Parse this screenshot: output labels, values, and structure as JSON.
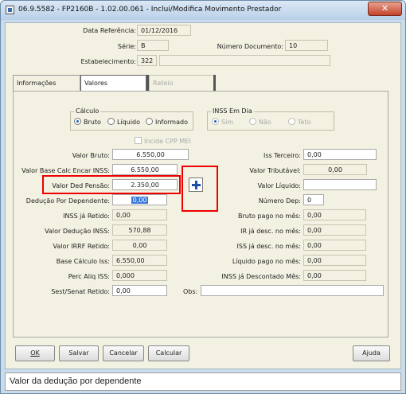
{
  "window": {
    "title": "06.9.5582 - FP2160B - 1.02.00.061 - Inclui/Modifica Movimento Prestador",
    "close_symbol": "✕"
  },
  "header": {
    "data_ref_label": "Data Referência:",
    "data_ref_value": "01/12/2016",
    "serie_label": "Série:",
    "serie_value": "B",
    "num_doc_label": "Número Documento:",
    "num_doc_value": "10",
    "estab_label": "Estabelecimento:",
    "estab_value": "322",
    "estab_desc": ""
  },
  "tabs": [
    {
      "label": "Informações"
    },
    {
      "label": "Valores"
    },
    {
      "label": "Rateio"
    }
  ],
  "calculo": {
    "title": "Cálculo",
    "options": [
      "Bruto",
      "Líquido",
      "Informado"
    ],
    "selected": "Bruto"
  },
  "inss_em_dia": {
    "title": "INSS Em Dia",
    "options": [
      "Sim",
      "Não",
      "Teto"
    ],
    "selected": "Sim"
  },
  "incide_cpp_mei": "Incide CPP MEI",
  "left_fields": [
    {
      "label": "Valor Bruto:",
      "value": "6.550,00"
    },
    {
      "label": "Valor Base Calc Encar INSS:",
      "value": "6.550,00"
    },
    {
      "label": "Valor Ded Pensão:",
      "value": "2.350,00"
    },
    {
      "label": "Dedução Por Dependente:",
      "value": "0,00"
    },
    {
      "label": "INSS já Retido:",
      "value": "0,00"
    },
    {
      "label": "Valor Dedução INSS:",
      "value": "570,88"
    },
    {
      "label": "Valor IRRF Retido:",
      "value": "0,00"
    },
    {
      "label": "Base Cálculo Iss:",
      "value": "6.550,00"
    },
    {
      "label": "Perc Aliq ISS:",
      "value": "0,000"
    },
    {
      "label": "Sest/Senat Retido:",
      "value": "0,00"
    }
  ],
  "right_fields": [
    {
      "label": "Iss Terceiro:",
      "value": "0,00"
    },
    {
      "label": "Valor Tributável:",
      "value": "0,00"
    },
    {
      "label": "Valor Líquido:",
      "value": ""
    },
    {
      "label": "Número Dep:",
      "value": "0"
    },
    {
      "label": "Bruto pago no mês:",
      "value": "0,00"
    },
    {
      "label": "IR já desc. no mês:",
      "value": "0,00"
    },
    {
      "label": "ISS já desc. no mês:",
      "value": "0,00"
    },
    {
      "label": "Líquido pago no mês:",
      "value": "0,00"
    },
    {
      "label": "INSS já Descontado Mês:",
      "value": "0,00"
    }
  ],
  "obs_label": "Obs:",
  "obs_value": "",
  "buttons": {
    "ok": "OK",
    "salvar": "Salvar",
    "cancelar": "Cancelar",
    "calcular": "Calcular",
    "ajuda": "Ajuda"
  },
  "status_text": "Valor da dedução por dependente",
  "colors": {
    "highlight_border": "#e00000",
    "selected_field": "#3c78d8",
    "plus_icon": "#1a4fa6"
  }
}
